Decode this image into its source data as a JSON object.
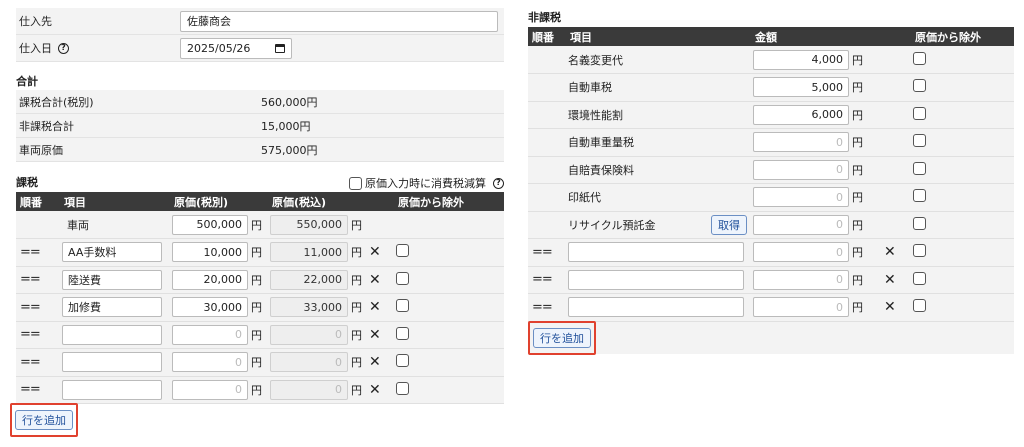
{
  "supplier": {
    "label": "仕入先",
    "value": "佐藤商会"
  },
  "purchase_date": {
    "label": "仕入日",
    "value": "2025/05/26"
  },
  "totals": {
    "title": "合計",
    "rows": [
      {
        "label": "課税合計(税別)",
        "value": "560,000円"
      },
      {
        "label": "非課税合計",
        "value": "15,000円"
      },
      {
        "label": "車両原価",
        "value": "575,000円"
      }
    ]
  },
  "taxable": {
    "title": "課税",
    "reduce_label": "原価入力時に消費税減算",
    "headers": [
      "順番",
      "項目",
      "原価(税別)",
      "原価(税込)",
      "原価から除外"
    ],
    "yen": "円",
    "vehicle": {
      "item": "車両",
      "ex": "500,000",
      "inc": "550,000"
    },
    "rows": [
      {
        "item": "AA手数料",
        "ex": "10,000",
        "inc": "11,000"
      },
      {
        "item": "陸送費",
        "ex": "20,000",
        "inc": "22,000"
      },
      {
        "item": "加修費",
        "ex": "30,000",
        "inc": "33,000"
      },
      {
        "item": "",
        "ex": "0",
        "inc": "0"
      },
      {
        "item": "",
        "ex": "0",
        "inc": "0"
      },
      {
        "item": "",
        "ex": "0",
        "inc": "0"
      }
    ],
    "add_row_label": "行を追加"
  },
  "nontaxable": {
    "title": "非課税",
    "headers": [
      "順番",
      "項目",
      "金額",
      "原価から除外"
    ],
    "yen": "円",
    "fixed_rows": [
      {
        "item": "名義変更代",
        "amount": "4,000"
      },
      {
        "item": "自動車税",
        "amount": "5,000"
      },
      {
        "item": "環境性能割",
        "amount": "6,000"
      },
      {
        "item": "自動車重量税",
        "amount": "0"
      },
      {
        "item": "自賠責保険料",
        "amount": "0"
      },
      {
        "item": "印紙代",
        "amount": "0"
      },
      {
        "item": "リサイクル預託金",
        "amount": "0",
        "button": "取得"
      }
    ],
    "custom_rows": [
      {
        "item": "",
        "amount": "0"
      },
      {
        "item": "",
        "amount": "0"
      },
      {
        "item": "",
        "amount": "0"
      }
    ],
    "add_row_label": "行を追加"
  }
}
